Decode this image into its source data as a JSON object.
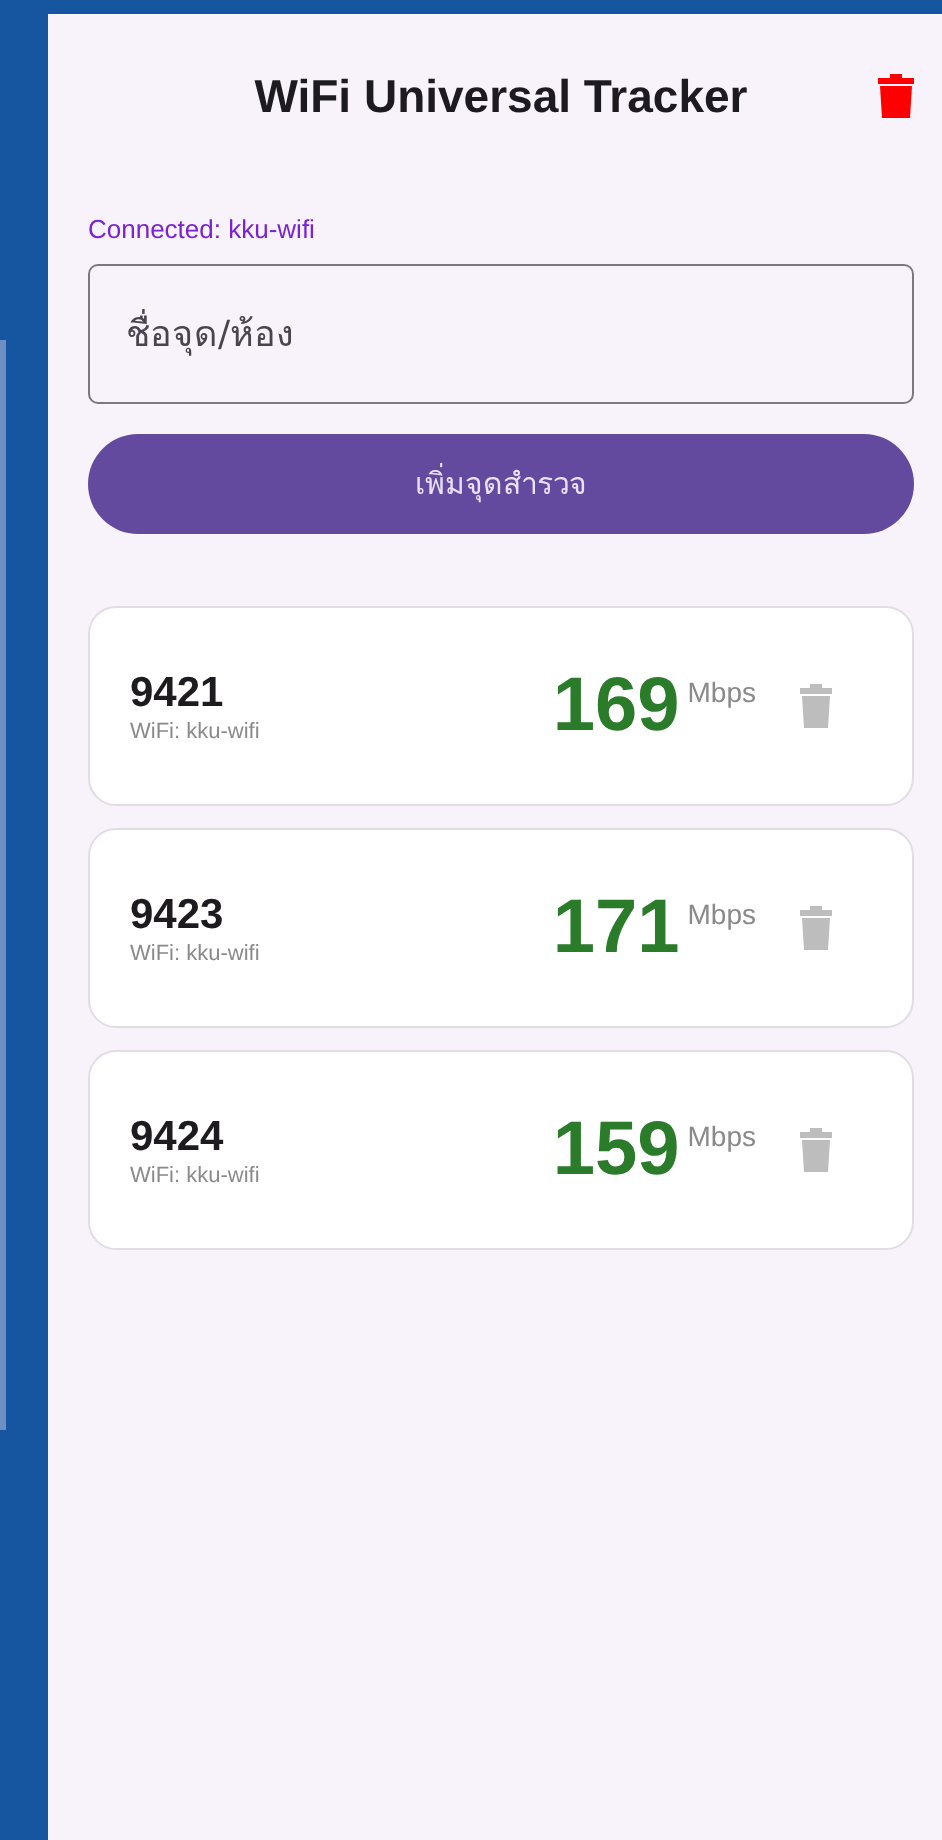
{
  "app_bar": {
    "title": "WiFi Universal Tracker"
  },
  "connection": {
    "label": "Connected: kku-wifi"
  },
  "name_field": {
    "placeholder": "ชื่อจุด/ห้อง"
  },
  "add_button": {
    "label": "เพิ่มจุดสำรวจ"
  },
  "points": [
    {
      "name": "9421",
      "network": "WiFi: kku-wifi",
      "speed": "169",
      "unit": "Mbps"
    },
    {
      "name": "9423",
      "network": "WiFi: kku-wifi",
      "speed": "171",
      "unit": "Mbps"
    },
    {
      "name": "9424",
      "network": "WiFi: kku-wifi",
      "speed": "159",
      "unit": "Mbps"
    }
  ]
}
